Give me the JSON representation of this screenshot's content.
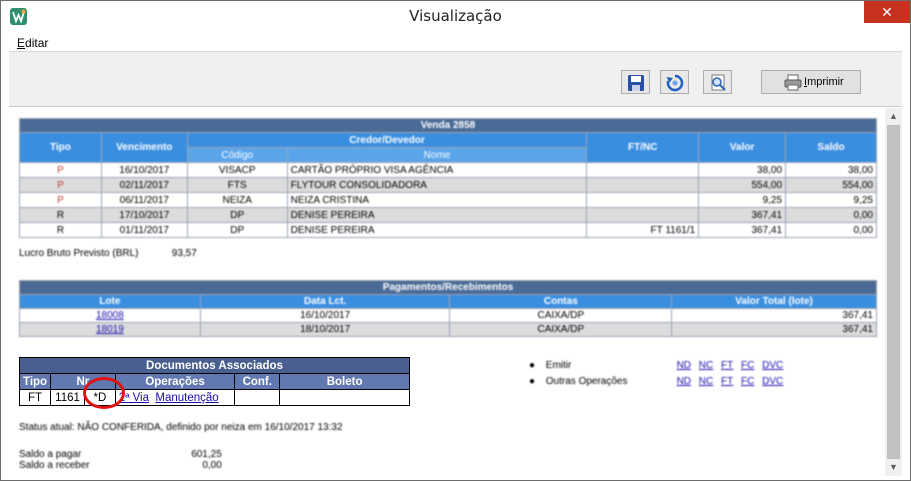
{
  "window": {
    "title": "Visualização",
    "close_glyph": "✕"
  },
  "menu": {
    "editar_prefix": "E",
    "editar_rest": "ditar"
  },
  "toolbar": {
    "print_prefix": "I",
    "print_rest": "mprimir"
  },
  "sale": {
    "caption": "Venda  2858",
    "headers": {
      "tipo": "Tipo",
      "vencimento": "Vencimento",
      "credor": "Credor/Devedor",
      "codigo": "Código",
      "nome": "Nome",
      "ft_nc": "FT/NC",
      "valor": "Valor",
      "saldo": "Saldo"
    },
    "rows": [
      {
        "tipo": "P",
        "vencimento": "16/10/2017",
        "codigo": "VISACP",
        "nome": "CARTÃO PRÓPRIO VISA AGÊNCIA",
        "ft_nc": "",
        "valor": "38,00",
        "saldo": "38,00"
      },
      {
        "tipo": "P",
        "vencimento": "02/11/2017",
        "codigo": "FTS",
        "nome": "FLYTOUR CONSOLIDADORA",
        "ft_nc": "",
        "valor": "554,00",
        "saldo": "554,00"
      },
      {
        "tipo": "P",
        "vencimento": "06/11/2017",
        "codigo": "NEIZA",
        "nome": "NEIZA CRISTINA",
        "ft_nc": "",
        "valor": "9,25",
        "saldo": "9,25"
      },
      {
        "tipo": "R",
        "vencimento": "17/10/2017",
        "codigo": "DP",
        "nome": "DENISE PEREIRA",
        "ft_nc": "",
        "valor": "367,41",
        "saldo": "0,00"
      },
      {
        "tipo": "R",
        "vencimento": "01/11/2017",
        "codigo": "DP",
        "nome": "DENISE PEREIRA",
        "ft_nc": "FT 1161/1",
        "valor": "367,41",
        "saldo": "0,00"
      }
    ]
  },
  "lucro": {
    "label": "Lucro Bruto Previsto (BRL)",
    "value": "93,57"
  },
  "payments": {
    "caption": "Pagamentos/Recebimentos",
    "headers": {
      "lote": "Lote",
      "data": "Data Lct.",
      "contas": "Contas",
      "valor": "Valor Total (lote)"
    },
    "rows": [
      {
        "lote": "18008",
        "data": "16/10/2017",
        "contas": "CAIXA/DP",
        "valor": "367,41"
      },
      {
        "lote": "18019",
        "data": "18/10/2017",
        "contas": "CAIXA/DP",
        "valor": "367,41"
      }
    ]
  },
  "documents": {
    "caption": "Documentos Associados",
    "headers": {
      "tipo": "Tipo",
      "nr": "Nr",
      "operacoes": "Operações",
      "conf": "Conf.",
      "boleto": "Boleto"
    },
    "rows": [
      {
        "tipo": "FT",
        "nr": "1161",
        "flag": "*D",
        "via": "2ª Via",
        "manut": "Manutenção",
        "conf": "",
        "boleto": ""
      }
    ]
  },
  "side_actions": [
    {
      "label": "Emitir",
      "links": [
        "ND",
        "NC",
        "FT",
        "FC",
        "DVC"
      ]
    },
    {
      "label": "Outras Operações",
      "links": [
        "ND",
        "NC",
        "FT",
        "FC",
        "DVC"
      ]
    }
  ],
  "status": {
    "text": "Status atual: NÃO CONFERIDA, definido por neiza em 16/10/2017 13:32"
  },
  "saldo": {
    "pagar_label": "Saldo a pagar",
    "pagar_value": "601,25",
    "receber_label": "Saldo a receber",
    "receber_value": "0,00"
  },
  "colors": {
    "table_caption": "#4a6b96",
    "table_header": "#3a8ee0",
    "doc_header": "#495f8f",
    "highlight_circle": "#e21212",
    "close_button": "#c7311f"
  },
  "icons": {
    "app": "app-logo-icon",
    "save": "save-icon",
    "refresh": "refresh-icon",
    "preview": "preview-icon",
    "printer": "printer-icon"
  }
}
